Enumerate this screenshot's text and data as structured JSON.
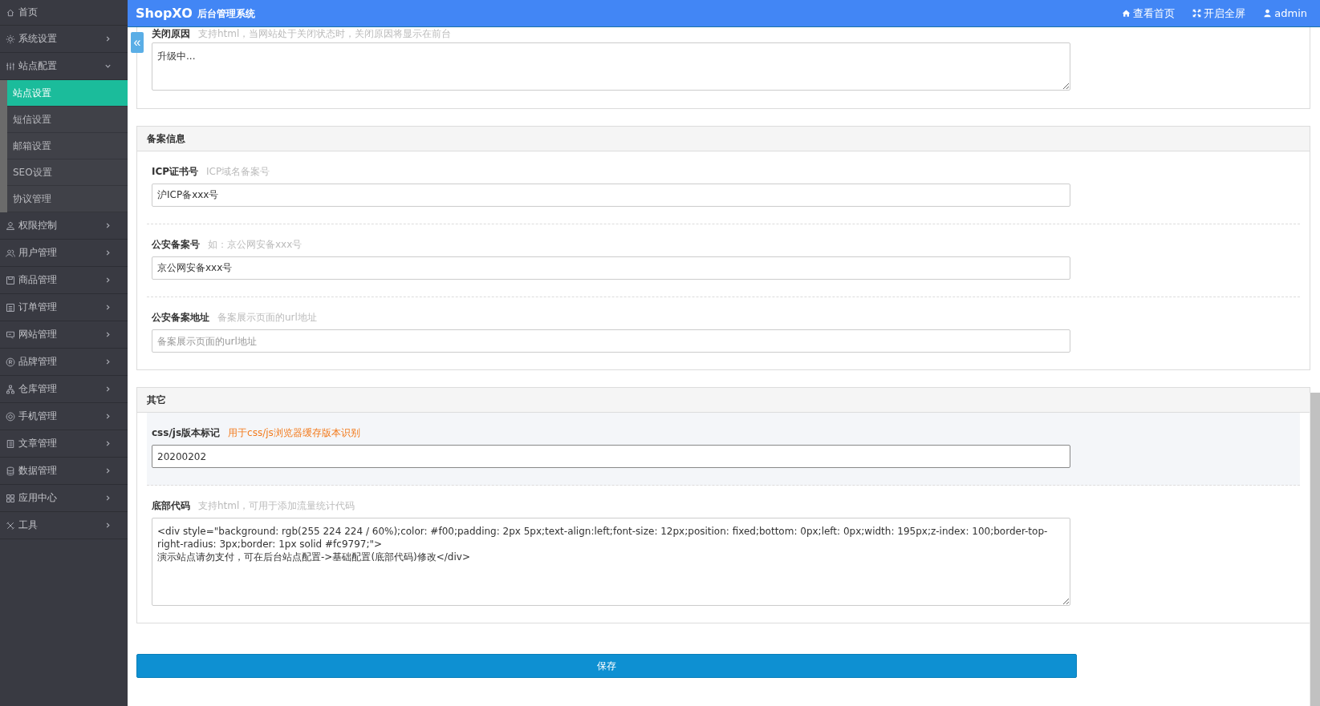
{
  "header": {
    "logo": "ShopXO",
    "subtitle": "后台管理系统",
    "actions": [
      {
        "label": "查看首页"
      },
      {
        "label": "开启全屏"
      },
      {
        "label": "admin"
      }
    ]
  },
  "collapse_button": {
    "label": "«"
  },
  "sidebar": {
    "items": [
      {
        "label": "首页",
        "kind": "link"
      },
      {
        "label": "系统设置",
        "kind": "menu",
        "expanded": false
      },
      {
        "label": "站点配置",
        "kind": "menu",
        "expanded": true,
        "children": [
          {
            "label": "站点设置",
            "selected": true
          },
          {
            "label": "短信设置",
            "selected": false
          },
          {
            "label": "邮箱设置",
            "selected": false
          },
          {
            "label": "SEO设置",
            "selected": false
          },
          {
            "label": "协议管理",
            "selected": false
          }
        ]
      },
      {
        "label": "权限控制",
        "kind": "menu",
        "expanded": false
      },
      {
        "label": "用户管理",
        "kind": "menu",
        "expanded": false
      },
      {
        "label": "商品管理",
        "kind": "menu",
        "expanded": false
      },
      {
        "label": "订单管理",
        "kind": "menu",
        "expanded": false
      },
      {
        "label": "网站管理",
        "kind": "menu",
        "expanded": false
      },
      {
        "label": "品牌管理",
        "kind": "menu",
        "expanded": false
      },
      {
        "label": "仓库管理",
        "kind": "menu",
        "expanded": false
      },
      {
        "label": "手机管理",
        "kind": "menu",
        "expanded": false
      },
      {
        "label": "文章管理",
        "kind": "menu",
        "expanded": false
      },
      {
        "label": "数据管理",
        "kind": "menu",
        "expanded": false
      },
      {
        "label": "应用中心",
        "kind": "menu",
        "expanded": false
      },
      {
        "label": "工具",
        "kind": "menu",
        "expanded": false
      }
    ]
  },
  "sections": [
    {
      "fields": [
        {
          "label": "关闭原因",
          "hint": "支持html，当网站处于关闭状态时，关闭原因将显示在前台",
          "kind": "textarea",
          "value": "升级中...",
          "focused": false
        }
      ]
    },
    {
      "title": "备案信息",
      "fields": [
        {
          "label": "ICP证书号",
          "hint": "ICP域名备案号",
          "kind": "input",
          "value": "沪ICP备xxx号",
          "focused": false
        },
        {
          "label": "公安备案号",
          "hint": "如：京公网安备xxx号",
          "kind": "input",
          "value": "京公网安备xxx号",
          "focused": false
        },
        {
          "label": "公安备案地址",
          "hint": "备案展示页面的url地址",
          "kind": "input",
          "placeholder": "备案展示页面的url地址",
          "focused": false
        }
      ]
    },
    {
      "title": "其它",
      "fields": [
        {
          "label": "css/js版本标记",
          "hint": "用于css/js浏览器缓存版本识别",
          "kind": "input",
          "value": "20200202",
          "focused": true
        },
        {
          "label": "底部代码",
          "hint": "支持html，可用于添加流量统计代码",
          "kind": "textarea",
          "value": "<div style=\"background: rgb(255 224 224 / 60%);color: #f00;padding: 2px 5px;text-align:left;font-size: 12px;position: fixed;bottom: 0px;left: 0px;width: 195px;z-index: 100;border-top-right-radius: 3px;border: 1px solid #fc9797;\">\n演示站点请勿支付，可在后台站点配置->基础配置(底部代码)修改</div>",
          "focused": false,
          "tall": true
        }
      ]
    }
  ],
  "save_button": {
    "label": "保存"
  }
}
